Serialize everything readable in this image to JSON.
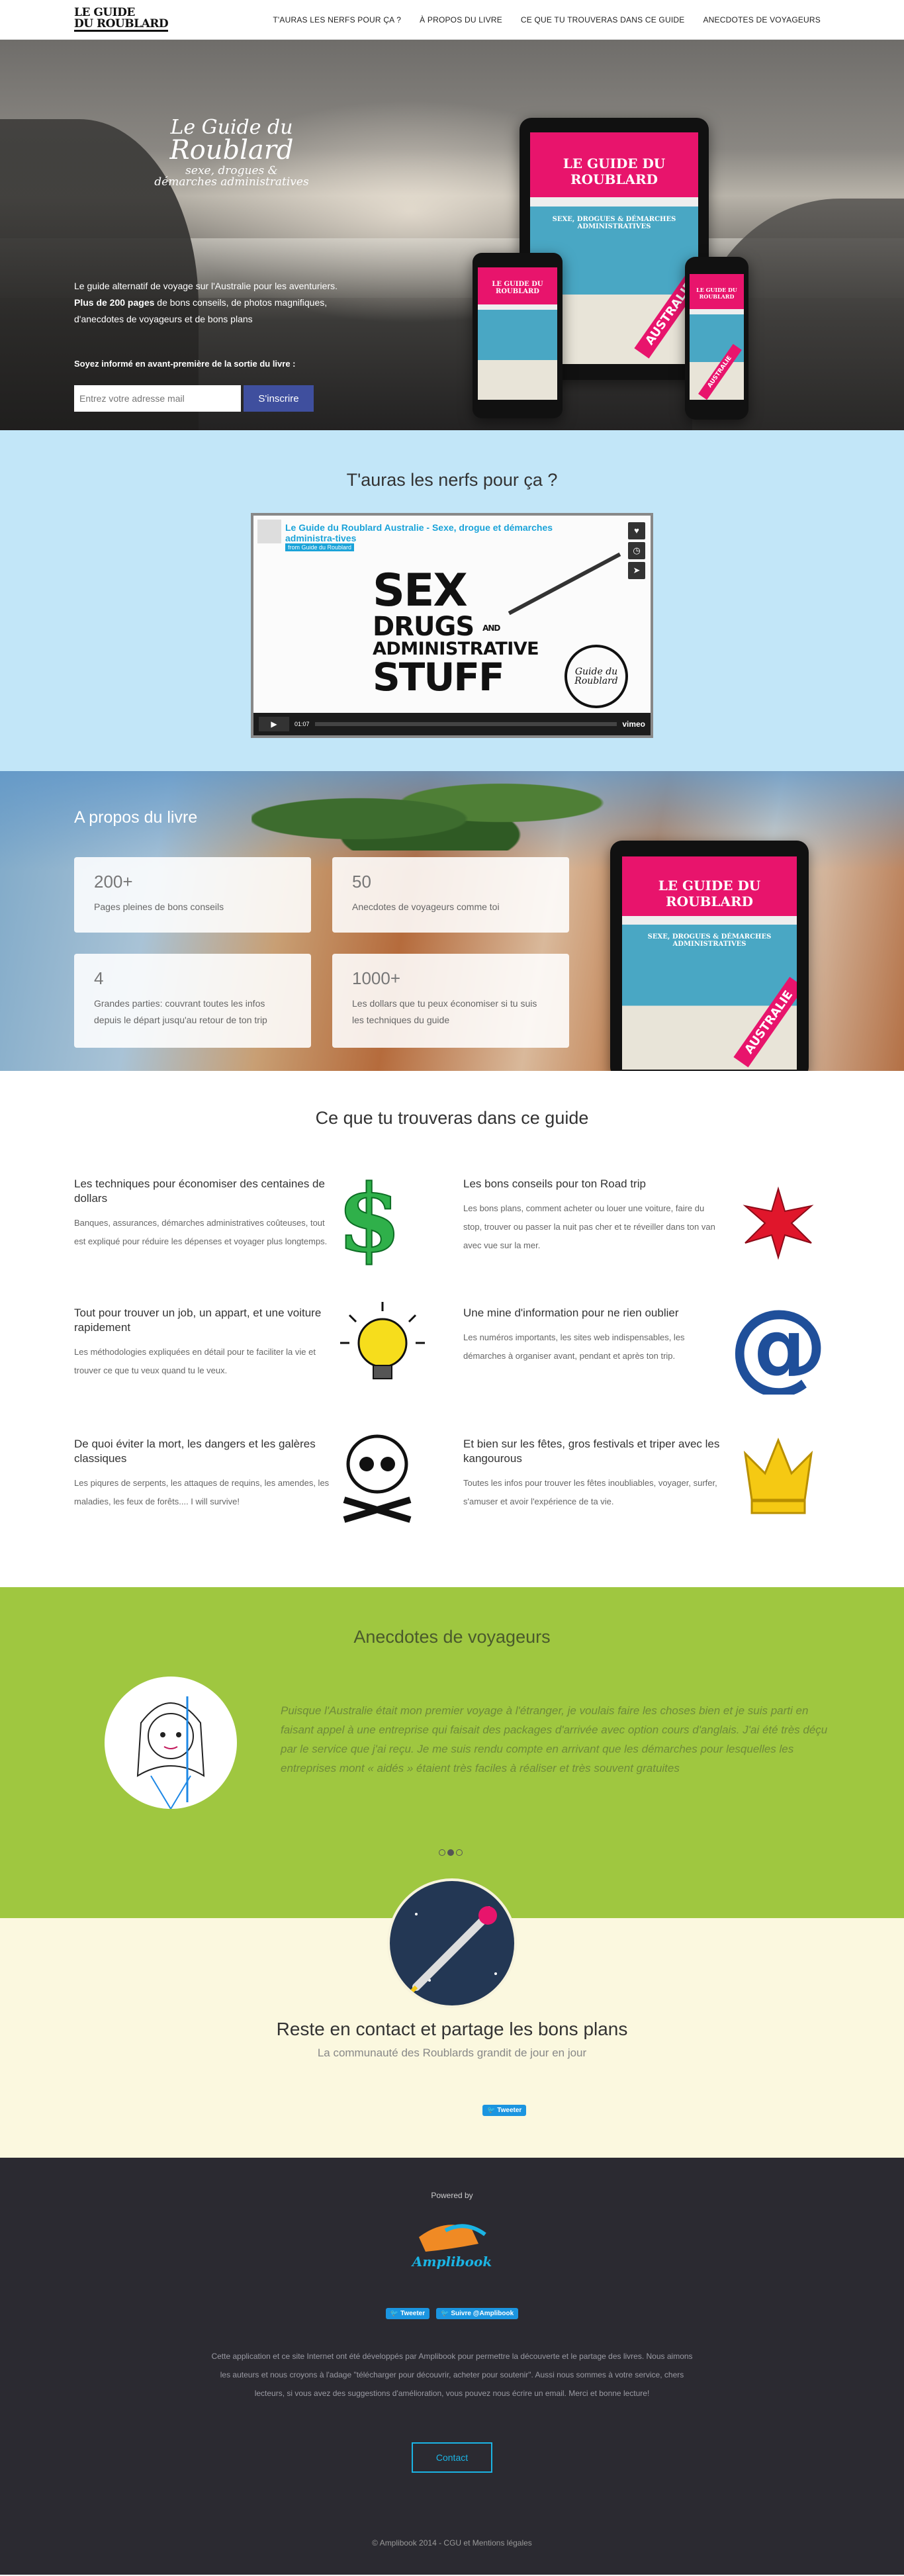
{
  "navbar": {
    "logo_line1": "LE GUIDE",
    "logo_line2": "DU ROUBLARD",
    "links": [
      "T'AURAS LES NERFS POUR ÇA ?",
      "À PROPOS DU LIVRE",
      "CE QUE TU TROUVERAS DANS CE GUIDE",
      "ANECDOTES DE VOYAGEURS"
    ]
  },
  "hero": {
    "title_line1": "Le Guide du",
    "title_line2": "Roublard",
    "title_line3": "sexe, drogues &",
    "title_line4": "démarches administratives",
    "desc_line1": "Le guide alternatif de voyage sur l'Australie pour les aventuriers.",
    "desc_bold": "Plus de 200 pages",
    "desc_line2": " de bons conseils, de photos magnifiques,",
    "desc_line3": "d'anecdotes de voyageurs et de bons plans",
    "cta": "Soyez informé en avant-première de la sortie du livre :",
    "email_placeholder": "Entrez votre adresse mail",
    "subscribe_label": "S'inscrire",
    "book_title": "LE GUIDE DU ROUBLARD",
    "book_subtitle": "SEXE, DROGUES & DÉMARCHES ADMINISTRATIVES",
    "book_country": "AUSTRALIE"
  },
  "video_section": {
    "title": "T'auras les nerfs pour ça ?",
    "video_title": "Le Guide du Roublard Australie - Sexe, drogue et démarches administra-tives",
    "video_from": "from Guide du Roublard",
    "big_line1": "SEX",
    "big_line2": "DRUGS",
    "big_line3": "ADMINISTRATIVE",
    "big_line4": "STUFF",
    "big_and": "AND",
    "badge_text": "Guide du Roublard",
    "time": "01:07",
    "vimeo": "vimeo"
  },
  "about": {
    "title": "A propos du livre",
    "cards": [
      {
        "num": "200+",
        "text": "Pages pleines de bons conseils"
      },
      {
        "num": "50",
        "text": "Anecdotes de voyageurs comme toi"
      },
      {
        "num": "4",
        "text": "Grandes parties: couvrant toutes les infos depuis le départ jusqu'au retour de ton trip"
      },
      {
        "num": "1000+",
        "text": "Les dollars que tu peux économiser si tu suis les techniques du guide"
      }
    ]
  },
  "guide": {
    "title": "Ce que tu trouveras dans ce guide",
    "features": [
      {
        "title": "Les techniques pour économiser des centaines de dollars",
        "text": "Banques, assurances, démarches administratives coûteuses, tout est expliqué pour réduire les dépenses et voyager plus longtemps.",
        "icon": "dollar-icon"
      },
      {
        "title": "Les bons conseils pour ton Road trip",
        "text": "Les bons plans, comment acheter ou louer une voiture, faire du stop, trouver ou passer la nuit pas cher et te réveiller dans ton van avec vue sur la mer.",
        "icon": "star-icon"
      },
      {
        "title": "Tout pour trouver un job, un appart, et une voiture rapidement",
        "text": "Les méthodologies expliquées en détail pour te faciliter la vie et trouver ce que tu veux quand tu le veux.",
        "icon": "lightbulb-icon"
      },
      {
        "title": "Une mine d'information pour ne rien oublier",
        "text": "Les numéros importants, les sites web indispensables, les démarches à organiser avant, pendant et après ton trip.",
        "icon": "at-sign-icon"
      },
      {
        "title": "De quoi éviter la mort, les dangers et les galères classiques",
        "text": "Les piqures de serpents, les attaques de requins, les amendes, les maladies, les feux de forêts.... I will survive!",
        "icon": "skull-icon"
      },
      {
        "title": "Et bien sur les fêtes, gros festivals et triper avec les kangourous",
        "text": "Toutes les infos pour trouver les fêtes inoubliables, voyager, surfer, s'amuser et avoir l'expérience de ta vie.",
        "icon": "crown-icon"
      }
    ]
  },
  "anecdotes": {
    "title": "Anecdotes de voyageurs",
    "quote": "Puisque l'Australie était mon premier voyage à l'étranger, je voulais faire les choses bien et je suis parti en faisant appel à une entreprise qui faisait des packages d'arrivée avec option cours d'anglais. J'ai été très déçu par le service que j'ai reçu. Je me suis rendu compte en arrivant que les démarches pour lesquelles les entreprises mont « aidés » étaient très faciles à réaliser et très souvent gratuites"
  },
  "contact": {
    "title": "Reste en contact et partage les bons plans",
    "subtitle": "La communauté des Roublards grandit de jour en jour",
    "tweet": "Tweeter"
  },
  "footer": {
    "powered": "Powered by",
    "amplibook": "Amplibook",
    "tweet": "Tweeter",
    "follow": "Suivre @Amplibook",
    "about": "Cette application et ce site Internet ont été développés par Amplibook pour permettre la découverte et le partage des livres. Nous aimons les auteurs et nous croyons à l'adage \"télécharger pour découvrir, acheter pour soutenir\". Aussi nous sommes à votre service, chers lecteurs, si vous avez des suggestions d'amélioration, vous pouvez nous écrire un email. Merci et bonne lecture!",
    "contact": "Contact",
    "copyright": "© Amplibook 2014 - CGU et Mentions légales"
  }
}
